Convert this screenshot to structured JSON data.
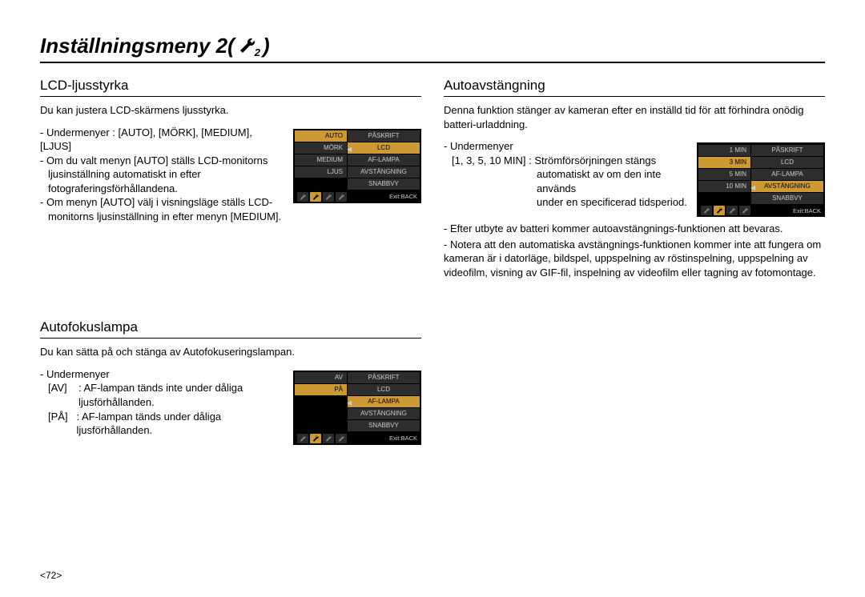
{
  "title": "Inställningsmeny 2(",
  "title_close": ")",
  "wrench_sub": "2",
  "page_number": "<72>",
  "exit_label": "Exit:BACK",
  "menu_right": {
    "r1": "PÅSKRIFT",
    "r2": "LCD",
    "r3": "AF-LAMPA",
    "r4": "AVSTÄNGNING",
    "r5": "SNABBVY"
  },
  "lcd": {
    "heading": "LCD-ljusstyrka",
    "intro": "Du kan justera LCD-skärmens ljusstyrka.",
    "b1": "- Undermenyer : [AUTO], [MÖRK], [MEDIUM], [LJUS]",
    "b2a": "- Om du valt menyn [AUTO] ställs LCD-monitorns",
    "b2b": "ljusinställning automatiskt in efter",
    "b2c": "fotograferingsförhållandena.",
    "b3a": "- Om menyn [AUTO] välj i visningsläge ställs LCD-",
    "b3b": "monitorns ljusinställning in efter menyn [MEDIUM].",
    "menu": {
      "o1": "AUTO",
      "o2": "MÖRK",
      "o3": "MEDIUM",
      "o4": "LJUS"
    }
  },
  "af": {
    "heading": "Autofokuslampa",
    "intro": "Du kan sätta på och stänga av Autofokuseringslampan.",
    "sub": "- Undermenyer",
    "l1a": "[AV]",
    "l1b": ": AF-lampan tänds inte under dåliga",
    "l1c": "ljusförhållanden.",
    "l2a": "[PÅ]",
    "l2b": ": AF-lampan tänds under dåliga ljusförhållanden.",
    "menu": {
      "o1": "AV",
      "o2": "PÅ"
    }
  },
  "auto": {
    "heading": "Autoavstängning",
    "intro": "Denna funktion stänger av kameran efter en inställd tid för att förhindra onödig batteri-urladdning.",
    "sub": "- Undermenyer",
    "l1a": "[1, 3, 5, 10 MIN]",
    "l1b": ": Strömförsörjningen stängs",
    "l1c": "automatiskt av om den inte används",
    "l1d": "under en specificerad tidsperiod.",
    "b2": "- Efter utbyte av batteri kommer autoavstängnings-funktionen att bevaras.",
    "b3": "- Notera att den automatiska avstängnings-funktionen kommer inte att fungera om kameran är i datorläge, bildspel, uppspelning av röstinspelning, uppspelning av videofilm, visning av GIF-fil, inspelning av videofilm eller tagning av fotomontage.",
    "menu": {
      "o1": "1 MIN",
      "o2": "3 MIN",
      "o3": "5 MIN",
      "o4": "10 MIN"
    }
  }
}
